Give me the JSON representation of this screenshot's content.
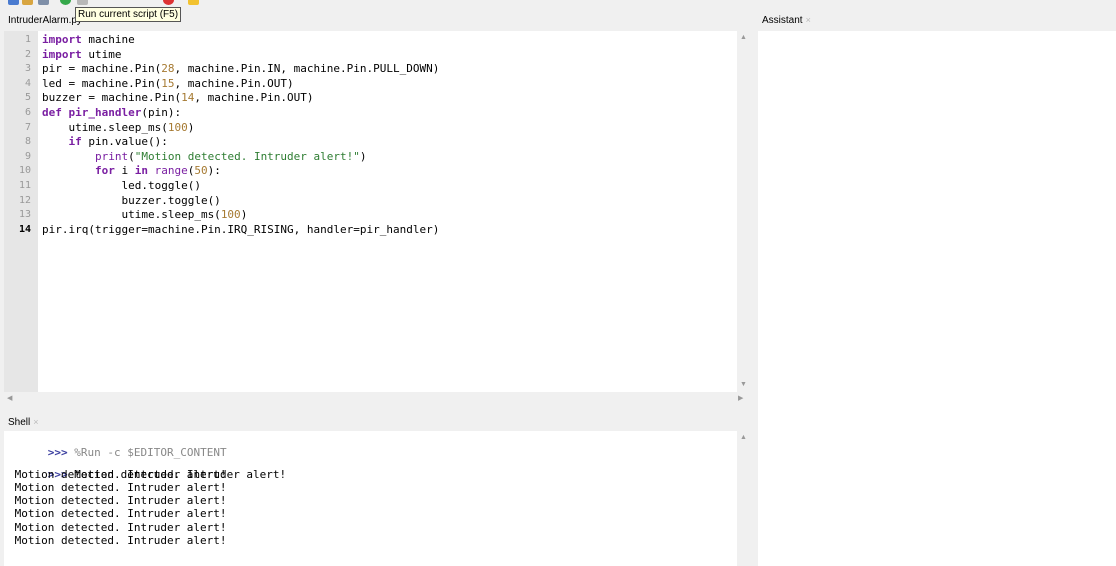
{
  "tooltip": "Run current script (F5)",
  "editor": {
    "tab_label": "IntruderAlarm.py",
    "current_line": 14,
    "lines": [
      {
        "n": "1"
      },
      {
        "n": "2"
      },
      {
        "n": "3"
      },
      {
        "n": "4"
      },
      {
        "n": "5"
      },
      {
        "n": "6"
      },
      {
        "n": "7"
      },
      {
        "n": "8"
      },
      {
        "n": "9"
      },
      {
        "n": "10"
      },
      {
        "n": "11"
      },
      {
        "n": "12"
      },
      {
        "n": "13"
      },
      {
        "n": "14"
      }
    ],
    "code": [
      [
        [
          "kw",
          "import"
        ],
        [
          "t",
          " machine"
        ]
      ],
      [
        [
          "kw",
          "import"
        ],
        [
          "t",
          " utime"
        ]
      ],
      [
        [
          "t",
          "pir = machine.Pin("
        ],
        [
          "num",
          "28"
        ],
        [
          "t",
          ", machine.Pin.IN, machine.Pin.PULL_DOWN)"
        ]
      ],
      [
        [
          "t",
          "led = machine.Pin("
        ],
        [
          "num",
          "15"
        ],
        [
          "t",
          ", machine.Pin.OUT)"
        ]
      ],
      [
        [
          "t",
          "buzzer = machine.Pin("
        ],
        [
          "num",
          "14"
        ],
        [
          "t",
          ", machine.Pin.OUT)"
        ]
      ],
      [
        [
          "kw",
          "def"
        ],
        [
          "t",
          " "
        ],
        [
          "kw",
          "pir_handler"
        ],
        [
          "t",
          "(pin):"
        ]
      ],
      [
        [
          "t",
          "    utime.sleep_ms("
        ],
        [
          "num",
          "100"
        ],
        [
          "t",
          ")"
        ]
      ],
      [
        [
          "t",
          "    "
        ],
        [
          "kw",
          "if"
        ],
        [
          "t",
          " pin.value():"
        ]
      ],
      [
        [
          "t",
          "        "
        ],
        [
          "fn",
          "print"
        ],
        [
          "t",
          "("
        ],
        [
          "str",
          "\"Motion detected. Intruder alert!\""
        ],
        [
          "t",
          ")"
        ]
      ],
      [
        [
          "t",
          "        "
        ],
        [
          "kw",
          "for"
        ],
        [
          "t",
          " i "
        ],
        [
          "kw",
          "in"
        ],
        [
          "t",
          " "
        ],
        [
          "fn",
          "range"
        ],
        [
          "t",
          "("
        ],
        [
          "num",
          "50"
        ],
        [
          "t",
          "):"
        ]
      ],
      [
        [
          "t",
          "            led.toggle()"
        ]
      ],
      [
        [
          "t",
          "            buzzer.toggle()"
        ]
      ],
      [
        [
          "t",
          "            utime.sleep_ms("
        ],
        [
          "num",
          "100"
        ],
        [
          "t",
          ")"
        ]
      ],
      [
        [
          "t",
          "pir.irq(trigger=machine.Pin.IRQ_RISING, handler=pir_handler)"
        ]
      ]
    ]
  },
  "shell": {
    "tab_label": "Shell",
    "prompt": ">>>",
    "command": " %Run -c $EDITOR_CONTENT",
    "first_output": " Motion detected. Intruder alert!",
    "output": [
      " Motion detected. Intruder alert!",
      " Motion detected. Intruder alert!",
      " Motion detected. Intruder alert!",
      " Motion detected. Intruder alert!",
      " Motion detected. Intruder alert!",
      " Motion detected. Intruder alert!"
    ]
  },
  "assistant": {
    "tab_label": "Assistant"
  },
  "icons": {
    "close": "close-icon",
    "scroll_up": "scroll-up-icon",
    "scroll_down": "scroll-down-icon",
    "scroll_left": "scroll-left-icon",
    "scroll_right": "scroll-right-icon"
  },
  "colors": {
    "keyword": "#7a1fa2",
    "number": "#a67a32",
    "string": "#2e7d32",
    "gutter": "#e6e6e6",
    "tooltip_bg": "#ffffe1"
  }
}
